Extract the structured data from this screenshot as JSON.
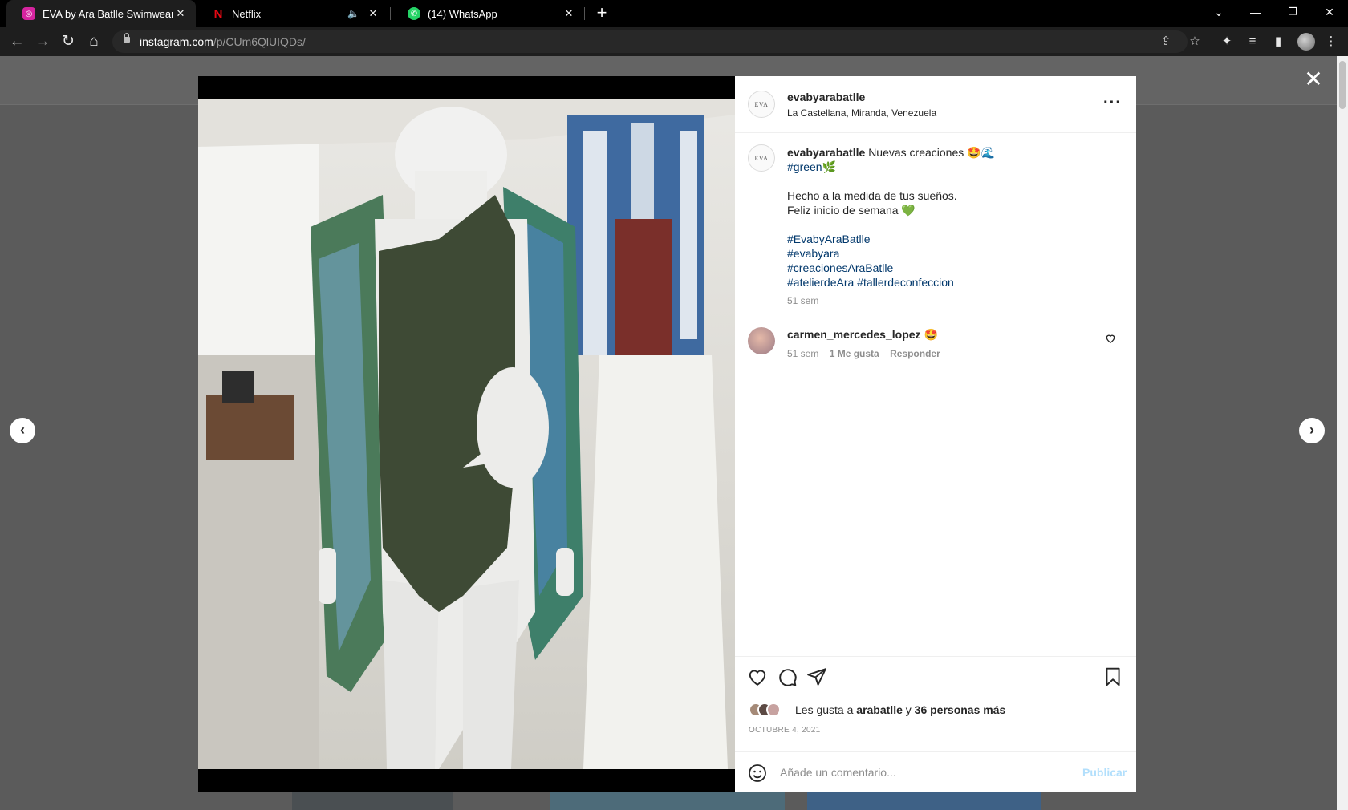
{
  "browser": {
    "tabs": [
      {
        "title": "EVA by Ara Batlle Swimwear (@",
        "favicon_color": "#d6249f",
        "favicon": "instagram-icon"
      },
      {
        "title": "Netflix",
        "favicon_color": "#e50914",
        "favicon": "netflix-icon"
      },
      {
        "title": "(14) WhatsApp",
        "favicon_color": "#25d366",
        "favicon": "whatsapp-icon"
      }
    ],
    "url_host": "instagram.com",
    "url_path": "/p/CUm6QlUIQDs/"
  },
  "post": {
    "account": {
      "username": "evabyarabatlle",
      "avatar_text": "EVA",
      "location": "La Castellana, Miranda, Venezuela"
    },
    "caption": {
      "username": "evabyarabatlle",
      "text": "Nuevas creaciones 🤩🌊",
      "tag_green": "#green🌿",
      "line1": "Hecho a la medida de tus sueños.",
      "line2": "Feliz inicio de semana 💚",
      "tags": [
        "#EvabyAraBatlle",
        "#evabyara",
        "#creacionesAraBatlle",
        "#atelierdeAra",
        "#tallerdeconfeccion"
      ],
      "age": "51 sem"
    },
    "comments": [
      {
        "username": "carmen_mercedes_lopez",
        "text": "🤩",
        "age": "51 sem",
        "likes": "1 Me gusta",
        "reply": "Responder"
      }
    ],
    "likes": {
      "prefix": "Les gusta a",
      "first_user": "arabatlle",
      "connector": "y",
      "others": "36 personas más"
    },
    "date": "OCTUBRE 4, 2021",
    "comment_box": {
      "placeholder": "Añade un comentario...",
      "publish": "Publicar"
    }
  },
  "colors": {
    "hashtag": "#00376b",
    "muted": "#8e8e8e",
    "publish_disabled": "#b2dffc",
    "swimsuit": "#3e4a35"
  }
}
